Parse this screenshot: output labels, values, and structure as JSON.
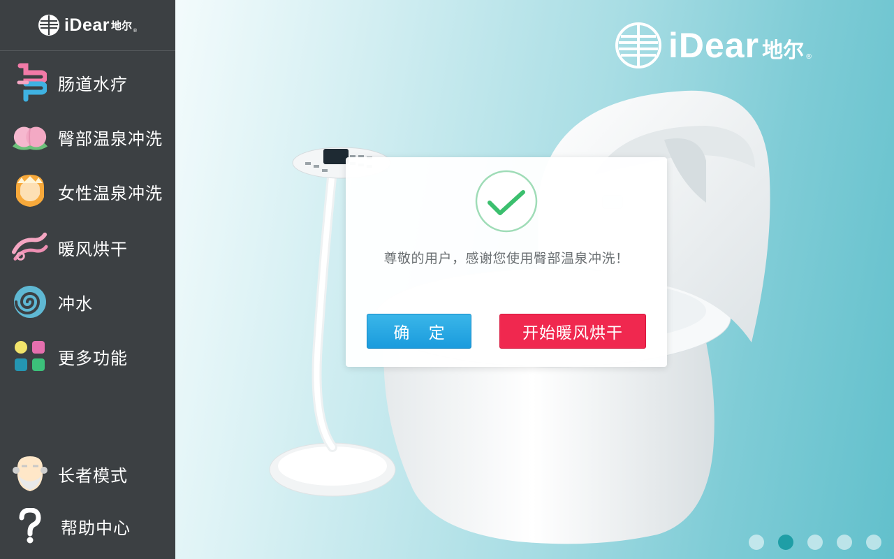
{
  "brand": {
    "wordmark": "iDear",
    "chinese": "地尔",
    "mark": "®"
  },
  "sidebar": {
    "items": [
      {
        "label": "肠道水疗",
        "icon": "intestine-icon"
      },
      {
        "label": "臀部温泉冲洗",
        "icon": "peach-icon"
      },
      {
        "label": "女性温泉冲洗",
        "icon": "woman-face-icon"
      },
      {
        "label": "暖风烘干",
        "icon": "warm-wind-icon"
      },
      {
        "label": "冲水",
        "icon": "swirl-icon"
      },
      {
        "label": "更多功能",
        "icon": "grid-icon"
      },
      {
        "label": "长者模式",
        "icon": "elder-face-icon"
      },
      {
        "label": "帮助中心",
        "icon": "question-icon"
      }
    ]
  },
  "dialog": {
    "message": "尊敬的用户，感谢您使用臀部温泉冲洗！",
    "confirm_label": "确 定",
    "dry_label": "开始暖风烘干",
    "icon": "check-circle-icon"
  },
  "pager": {
    "count": 5,
    "active_index": 1
  },
  "colors": {
    "sidebar_bg": "#3c4043",
    "accent_blue": "#1a9bdd",
    "accent_red": "#f0284f",
    "check_green": "#3bbf6e",
    "pager_active": "#1f9ea6"
  }
}
